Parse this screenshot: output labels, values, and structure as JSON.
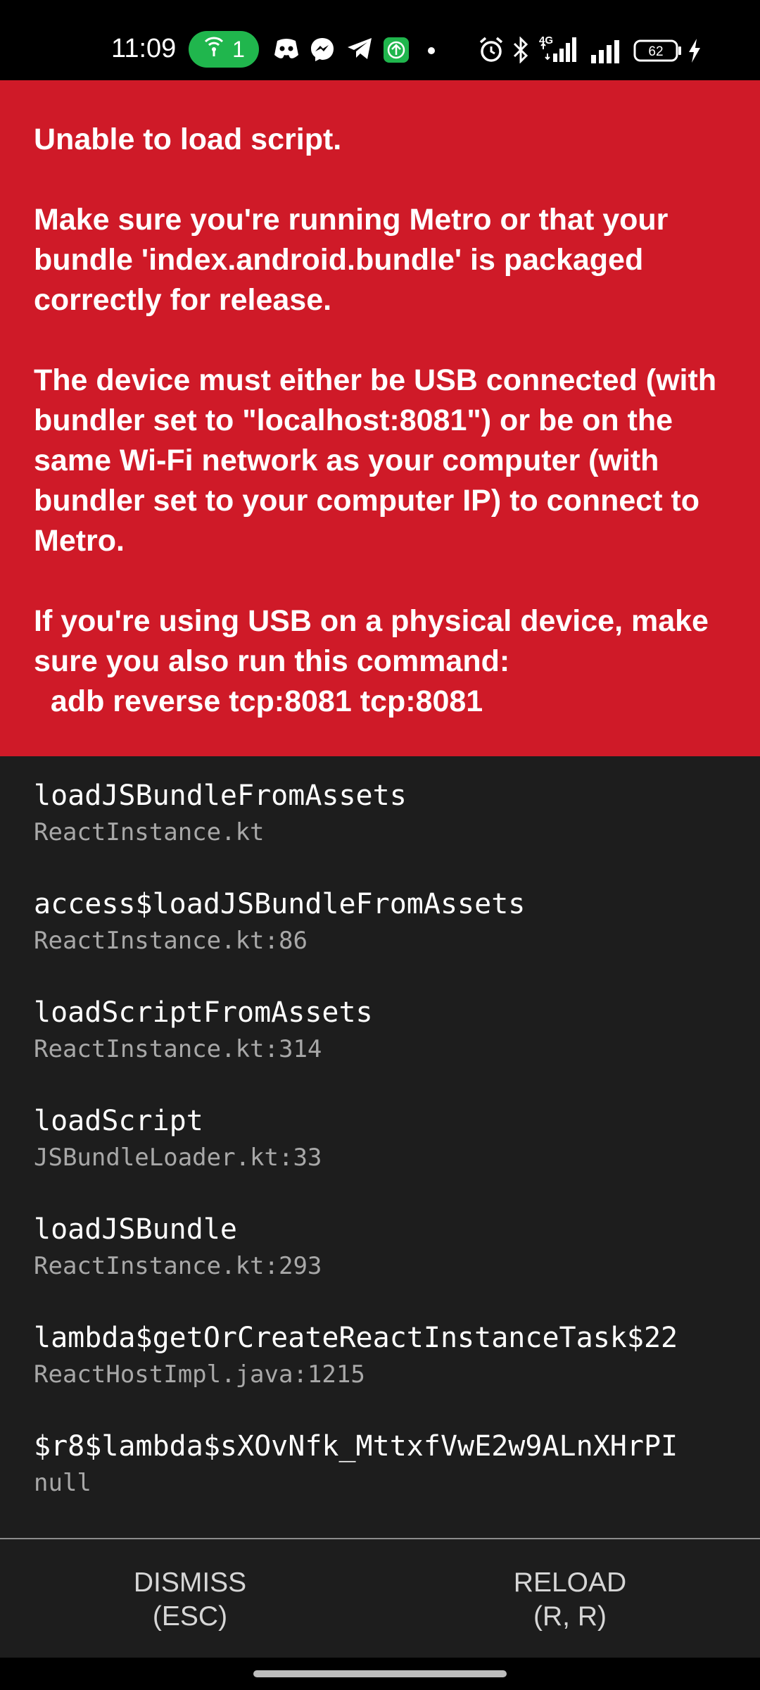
{
  "status_bar": {
    "time": "11:09",
    "hotspot_count": "1",
    "battery_level": "62",
    "network_label": "4G",
    "icons": [
      "hotspot-icon",
      "discord-icon",
      "messenger-icon",
      "telegram-icon",
      "upload-icon",
      "dot-icon",
      "alarm-icon",
      "bluetooth-icon",
      "signal-4g-icon",
      "signal-icon",
      "battery-icon",
      "charging-icon"
    ]
  },
  "error": {
    "message": "Unable to load script.\n\nMake sure you're running Metro or that your bundle 'index.android.bundle' is packaged correctly for release.\n\nThe device must either be USB connected (with bundler set to \"localhost:8081\") or be on the same Wi-Fi network as your computer (with bundler set to your computer IP) to connect to Metro.\n\nIf you're using USB on a physical device, make sure you also run this command:\n  adb reverse tcp:8081 tcp:8081",
    "background_color": "#cf1a28"
  },
  "stack": [
    {
      "method": "loadJSBundleFromAssets",
      "file": "ReactInstance.kt"
    },
    {
      "method": "access$loadJSBundleFromAssets",
      "file": "ReactInstance.kt:86"
    },
    {
      "method": "loadScriptFromAssets",
      "file": "ReactInstance.kt:314"
    },
    {
      "method": "loadScript",
      "file": "JSBundleLoader.kt:33"
    },
    {
      "method": "loadJSBundle",
      "file": "ReactInstance.kt:293"
    },
    {
      "method": "lambda$getOrCreateReactInstanceTask$22",
      "file": "ReactHostImpl.java:1215"
    },
    {
      "method": "$r8$lambda$sXOvNfk_MttxfVwE2w9ALnXHrPI",
      "file": "null"
    }
  ],
  "buttons": {
    "dismiss_label": "DISMISS",
    "dismiss_shortcut": "(ESC)",
    "reload_label": "RELOAD",
    "reload_shortcut": "(R, R)"
  }
}
